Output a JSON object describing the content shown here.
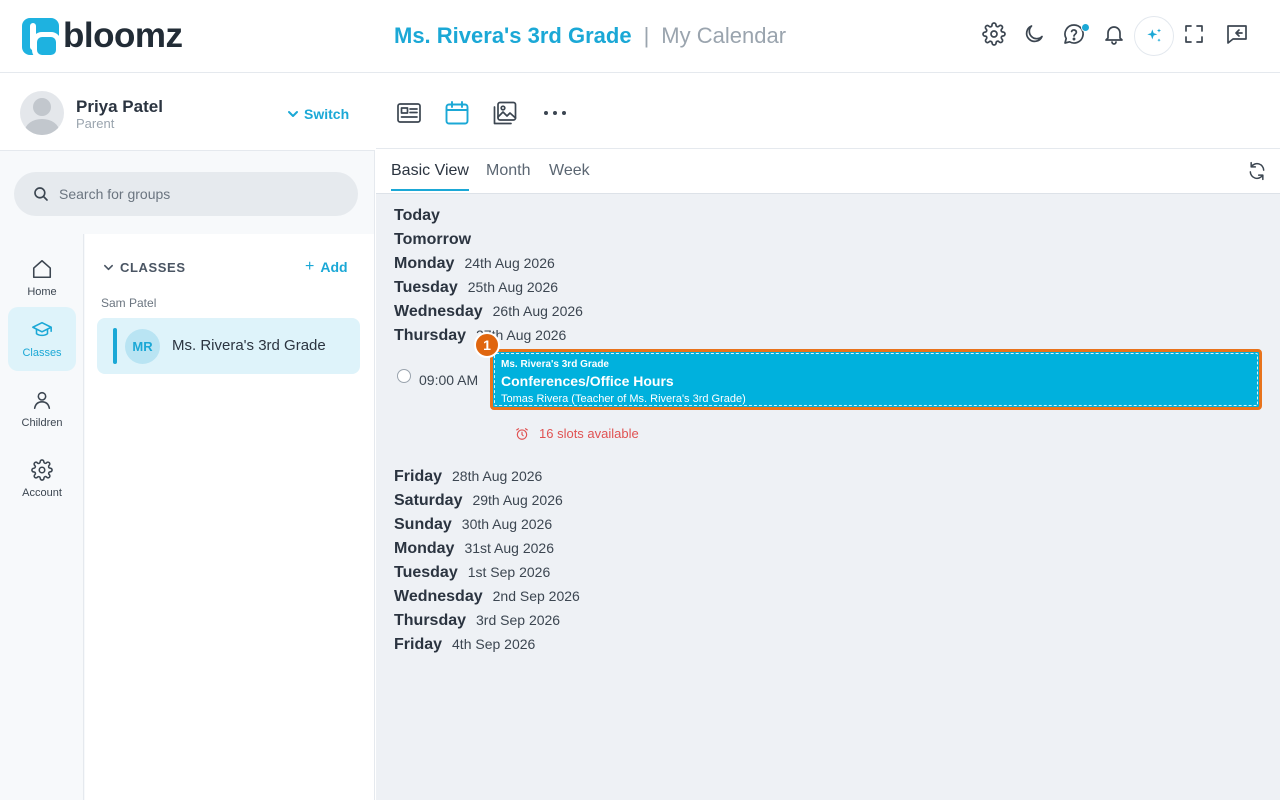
{
  "brand": {
    "name": "bloomz"
  },
  "header": {
    "title": "Ms. Rivera's 3rd Grade",
    "separator": "|",
    "subtitle": "My Calendar",
    "icons": [
      "gear-icon",
      "moon-icon",
      "help-icon",
      "bell-icon",
      "sparkle-icon",
      "fullscreen-icon",
      "message-back-icon"
    ]
  },
  "profile": {
    "name": "Priya Patel",
    "role": "Parent",
    "switch_label": "Switch"
  },
  "search": {
    "placeholder": "Search for groups"
  },
  "nav": {
    "items": [
      {
        "label": "Home",
        "icon": "home-icon",
        "active": false
      },
      {
        "label": "Classes",
        "icon": "graduation-cap-icon",
        "active": true
      },
      {
        "label": "Children",
        "icon": "person-icon",
        "active": false
      },
      {
        "label": "Account",
        "icon": "gear-icon",
        "active": false
      }
    ]
  },
  "groups": {
    "section_label": "CLASSES",
    "add_label": "Add",
    "owner": "Sam Patel",
    "items": [
      {
        "initials": "MR",
        "name": "Ms. Rivera's 3rd Grade"
      }
    ]
  },
  "toolbar": {
    "icons": [
      "news-icon",
      "calendar-icon",
      "photos-icon",
      "more-icon"
    ],
    "active": "calendar-icon"
  },
  "tabs": [
    "Basic View",
    "Month",
    "Week"
  ],
  "calendar": {
    "days_before": [
      {
        "day": "Today",
        "date": ""
      },
      {
        "day": "Tomorrow",
        "date": ""
      },
      {
        "day": "Monday",
        "date": "24th Aug 2026"
      },
      {
        "day": "Tuesday",
        "date": "25th Aug 2026"
      },
      {
        "day": "Wednesday",
        "date": "26th Aug 2026"
      },
      {
        "day": "Thursday",
        "date": "27th Aug 2026"
      }
    ],
    "event": {
      "badge": "1",
      "time": "09:00 AM",
      "group": "Ms. Rivera's 3rd Grade",
      "title": "Conferences/Office Hours",
      "teacher": "Tomas Rivera (Teacher of Ms. Rivera's 3rd Grade)",
      "slots": "16 slots available"
    },
    "days_after": [
      {
        "day": "Friday",
        "date": "28th Aug 2026"
      },
      {
        "day": "Saturday",
        "date": "29th Aug 2026"
      },
      {
        "day": "Sunday",
        "date": "30th Aug 2026"
      },
      {
        "day": "Monday",
        "date": "31st Aug 2026"
      },
      {
        "day": "Tuesday",
        "date": "1st Sep 2026"
      },
      {
        "day": "Wednesday",
        "date": "2nd Sep 2026"
      },
      {
        "day": "Thursday",
        "date": "3rd Sep 2026"
      },
      {
        "day": "Friday",
        "date": "4th Sep 2026"
      }
    ]
  },
  "colors": {
    "accent": "#1ba8d6",
    "event_bg": "#00b1dd",
    "event_highlight": "#e8731c",
    "slots_text": "#e05252"
  }
}
